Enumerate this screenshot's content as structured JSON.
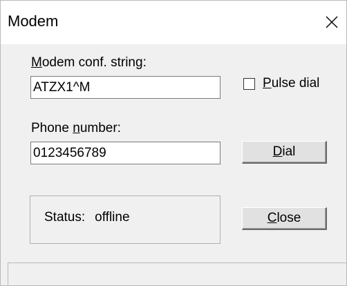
{
  "window": {
    "title": "Modem",
    "close_icon": "close-x-icon"
  },
  "modem_conf": {
    "label_prefix_underlined": "M",
    "label_rest": "odem conf. string:",
    "value": "ATZX1^M"
  },
  "pulse_dial": {
    "label_prefix_underlined": "P",
    "label_rest": "ulse dial",
    "checked": false
  },
  "phone_number": {
    "label_before": "Phone ",
    "label_underlined": "n",
    "label_after": "umber:",
    "value": "0123456789"
  },
  "buttons": {
    "dial_underlined": "D",
    "dial_rest": "ial",
    "close_underlined": "C",
    "close_rest": "lose"
  },
  "status": {
    "label": "Status:",
    "value": "offline"
  }
}
